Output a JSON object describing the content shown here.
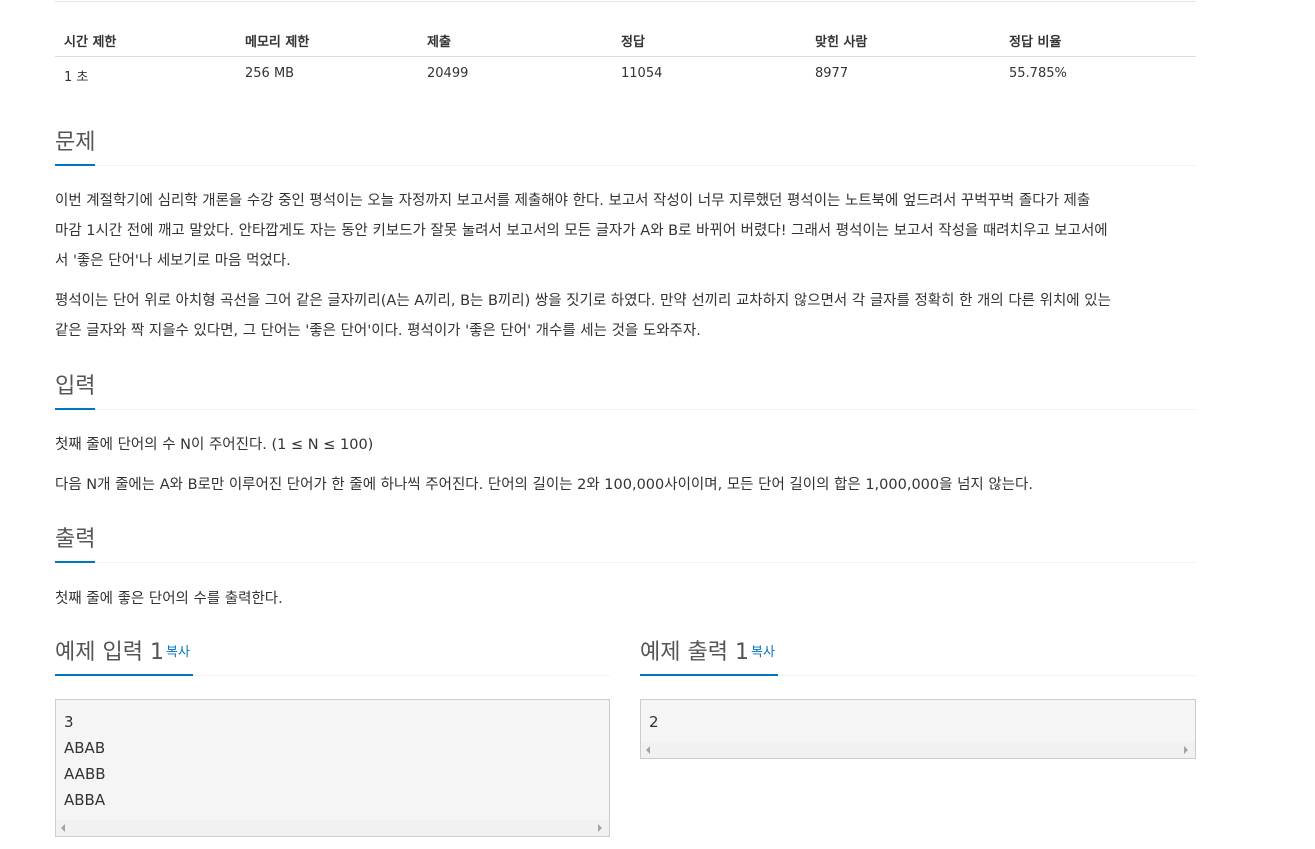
{
  "stats": {
    "headers": [
      "시간 제한",
      "메모리 제한",
      "제출",
      "정답",
      "맞힌 사람",
      "정답 비율"
    ],
    "values": [
      "1 초",
      "256 MB",
      "20499",
      "11054",
      "8977",
      "55.785%"
    ]
  },
  "problem": {
    "title": "문제",
    "paragraphs": [
      [
        "이번 계절학기에 심리학 개론을 수강 중인 평석이는 오늘 자정까지 보고서를 제출해야 한다. 보고서 작성이 너무 지루했던 평석이는 노트북에 엎드려서 꾸벅꾸벅 졸다가 제출",
        "마감 1시간 전에 깨고 말았다. 안타깝게도 자는 동안 키보드가 잘못 눌려서 보고서의 모든 글자가 A와 B로 바뀌어 버렸다! 그래서 평석이는 보고서 작성을 때려치우고 보고서에",
        "서 '좋은 단어'나 세보기로 마음 먹었다."
      ],
      [
        "평석이는 단어 위로 아치형 곡선을 그어 같은 글자끼리(A는 A끼리, B는 B끼리) 쌍을 짓기로 하였다. 만약 선끼리 교차하지 않으면서 각 글자를 정확히 한 개의 다른 위치에 있는",
        "같은 글자와 짝 지을수 있다면, 그 단어는 '좋은 단어'이다. 평석이가 '좋은 단어' 개수를 세는 것을 도와주자."
      ]
    ]
  },
  "input": {
    "title": "입력",
    "paragraphs": [
      "첫째 줄에 단어의 수 N이 주어진다. (1 ≤ N ≤ 100)",
      "다음 N개 줄에는 A와 B로만 이루어진 단어가 한 줄에 하나씩 주어진다. 단어의 길이는 2와 100,000사이이며, 모든 단어 길이의 합은 1,000,000을 넘지 않는다."
    ]
  },
  "output": {
    "title": "출력",
    "paragraphs": [
      "첫째 줄에 좋은 단어의 수를 출력한다."
    ]
  },
  "samples": {
    "input": {
      "title": "예제 입력 1",
      "copy_label": "복사",
      "lines": [
        "3",
        "ABAB",
        "AABB",
        "ABBA"
      ]
    },
    "output": {
      "title": "예제 출력 1",
      "copy_label": "복사",
      "lines": [
        "2"
      ]
    }
  },
  "colors": {
    "accent": "#0076c0",
    "pre_bg": "#f5f5f5"
  }
}
